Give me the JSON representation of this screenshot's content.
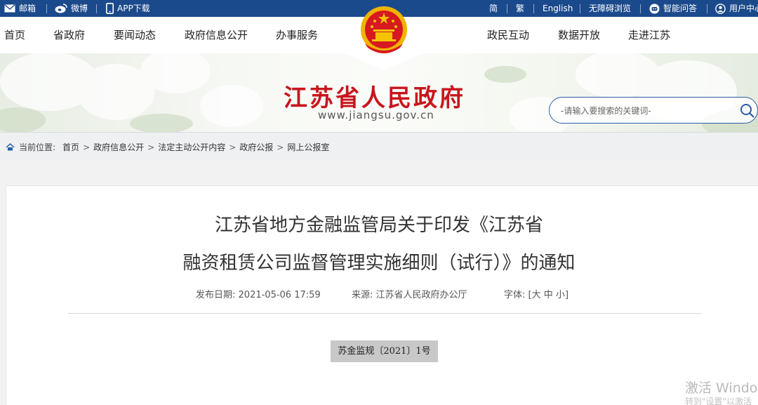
{
  "topbar": {
    "mail_label": "邮箱",
    "weibo_label": "微博",
    "app_label": "APP下载",
    "simplified_label": "简",
    "traditional_label": "繁",
    "english_label": "English",
    "accessibility_label": "无障碍浏览",
    "qa_label": "智能问答",
    "user_label": "用户中心"
  },
  "nav": {
    "left": [
      "首页",
      "省政府",
      "要闻动态",
      "政府信息公开",
      "办事服务"
    ],
    "right": [
      "政民互动",
      "数据开放",
      "走进江苏"
    ]
  },
  "banner": {
    "site_title": "江苏省人民政府",
    "site_url": "www.jiangsu.gov.cn"
  },
  "search": {
    "placeholder": "-请输入要搜索的关键词-"
  },
  "breadcrumb": {
    "label": "当前位置:",
    "items": [
      "首页",
      "政府信息公开",
      "法定主动公开内容",
      "政府公报",
      "网上公报室"
    ]
  },
  "article": {
    "title_line1": "江苏省地方金融监管局关于印发《江苏省",
    "title_line2": "融资租赁公司监督管理实施细则（试行）》的通知",
    "date_label": "发布日期:",
    "date": "2021-05-06 17:59",
    "source_label": "来源:",
    "source": "江苏省人民政府办公厅",
    "font_label": "字体:",
    "font_open": "[",
    "font_large": "大",
    "font_medium": "中",
    "font_small": "小",
    "font_close": "]",
    "doc_number": "苏金监规〔2021〕1号"
  },
  "watermark": {
    "line1": "激活 Windows",
    "line2": "转到\"设置\"以激活"
  },
  "colors": {
    "topbar": "#1b4a8c",
    "title_red": "#c8161d",
    "search_border": "#2a5da8"
  }
}
